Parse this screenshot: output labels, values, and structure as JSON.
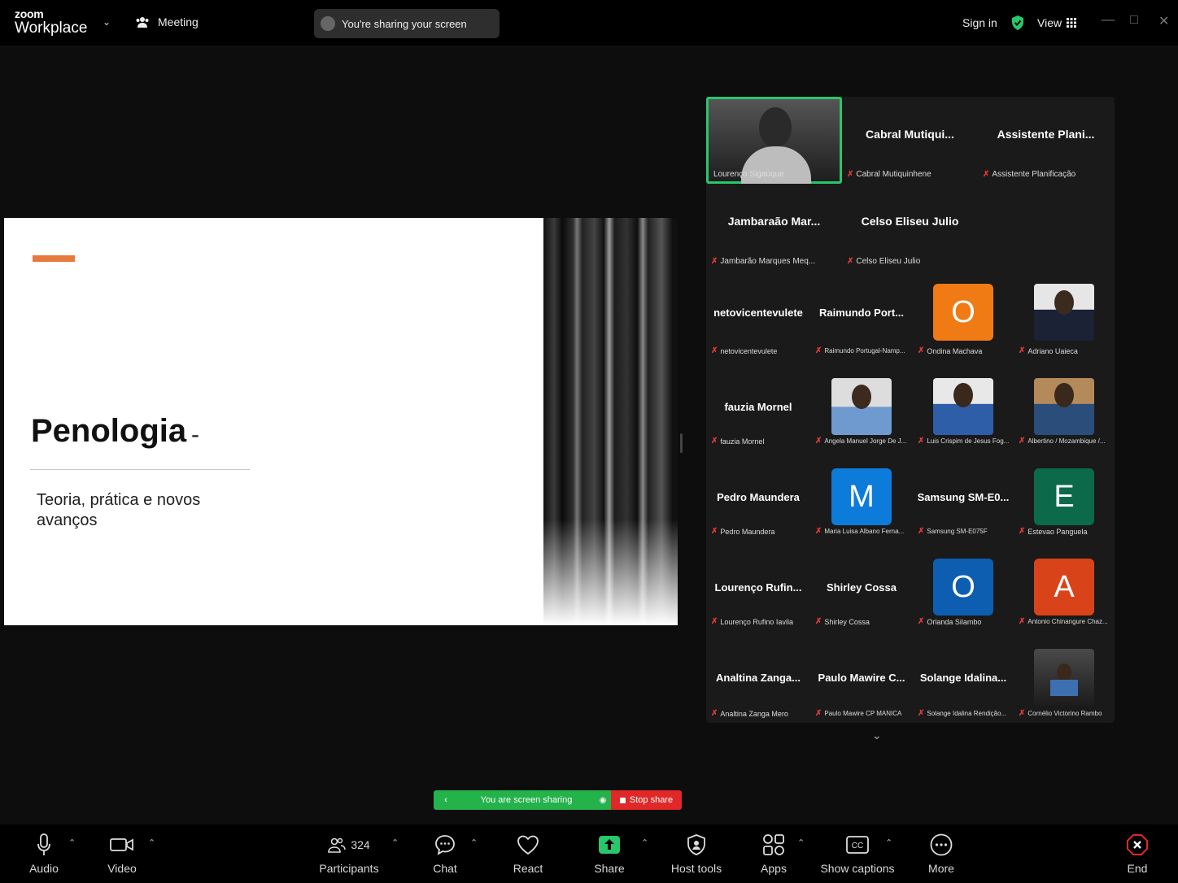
{
  "titlebar": {
    "logo_top": "zoom",
    "logo_bottom": "Workplace",
    "meeting_label": "Meeting",
    "sharing_status": "You're sharing your screen",
    "sign_in": "Sign in",
    "view": "View"
  },
  "slide": {
    "title": "Penologia",
    "dash": "-",
    "subtitle": "Teoria, prática e novos avanços",
    "accent_color": "#e8793d"
  },
  "gallery": {
    "tiles": [
      {
        "name": "",
        "label": "Lourenço Sigaúque"
      },
      {
        "name": "Cabral Mutiqui...",
        "label": "Cabral Mutiquinhene"
      },
      {
        "name": "Assistente Plani...",
        "label": "Assistente Planificação"
      },
      {
        "name": "Jambaraão Mar...",
        "label": "Jambarão Marques Meq..."
      },
      {
        "name": "Celso Eliseu Julio",
        "label": "Celso Eliseu Julio"
      },
      {
        "name": "netovicentevulete",
        "label": "netovicentevulete"
      },
      {
        "name": "Raimundo Port...",
        "label": "Raimundo Portugal-Namp..."
      },
      {
        "letter": "O",
        "label": "Ondina Machava",
        "color": "#f07b14"
      },
      {
        "label": "Adriano Uaieca"
      },
      {
        "name": "fauzia Mornel",
        "label": "fauzia Mornel"
      },
      {
        "label": "Angela Manuel Jorge De J..."
      },
      {
        "label": "Luis Crispim de Jesus Fog..."
      },
      {
        "label": "Albertino / Mozambique /..."
      },
      {
        "name": "Pedro Maundera",
        "label": "Pedro Maundera"
      },
      {
        "letter": "M",
        "label": "Maria Luisa Albano Ferna...",
        "color": "#0d7bd9"
      },
      {
        "name": "Samsung SM-E0...",
        "label": "Samsung SM-E075F"
      },
      {
        "letter": "E",
        "label": "Estevao Panguela",
        "color": "#0c6a4a"
      },
      {
        "name": "Lourenço Rufin...",
        "label": "Lourenço Rufino Iavila"
      },
      {
        "name": "Shirley Cossa",
        "label": "Shirley Cossa"
      },
      {
        "letter": "O",
        "label": "Orlanda Silambo",
        "color": "#0d5eb0"
      },
      {
        "letter": "A",
        "label": "Antonio Chinangure Chaz...",
        "color": "#d9431a"
      },
      {
        "name": "Analtina Zanga...",
        "label": "Analtina Zanga Mero"
      },
      {
        "name": "Paulo Mawire C...",
        "label": "Paulo Mawire CP MANICA"
      },
      {
        "name": "Solange Idalina...",
        "label": "Solange Idalina Rendição..."
      },
      {
        "label": "Cornélio Victorino Rambo"
      }
    ]
  },
  "share_bar": {
    "status": "You are screen sharing",
    "stop": "Stop share"
  },
  "toolbar": {
    "audio": "Audio",
    "video": "Video",
    "participants": "Participants",
    "participant_count": "324",
    "chat": "Chat",
    "react": "React",
    "share": "Share",
    "host_tools": "Host tools",
    "apps": "Apps",
    "captions": "Show captions",
    "more": "More",
    "end": "End"
  },
  "colors": {
    "share_green": "#24b24b",
    "stop_red": "#e02828",
    "active_speaker": "#29c66b",
    "end_red": "#e02828"
  }
}
